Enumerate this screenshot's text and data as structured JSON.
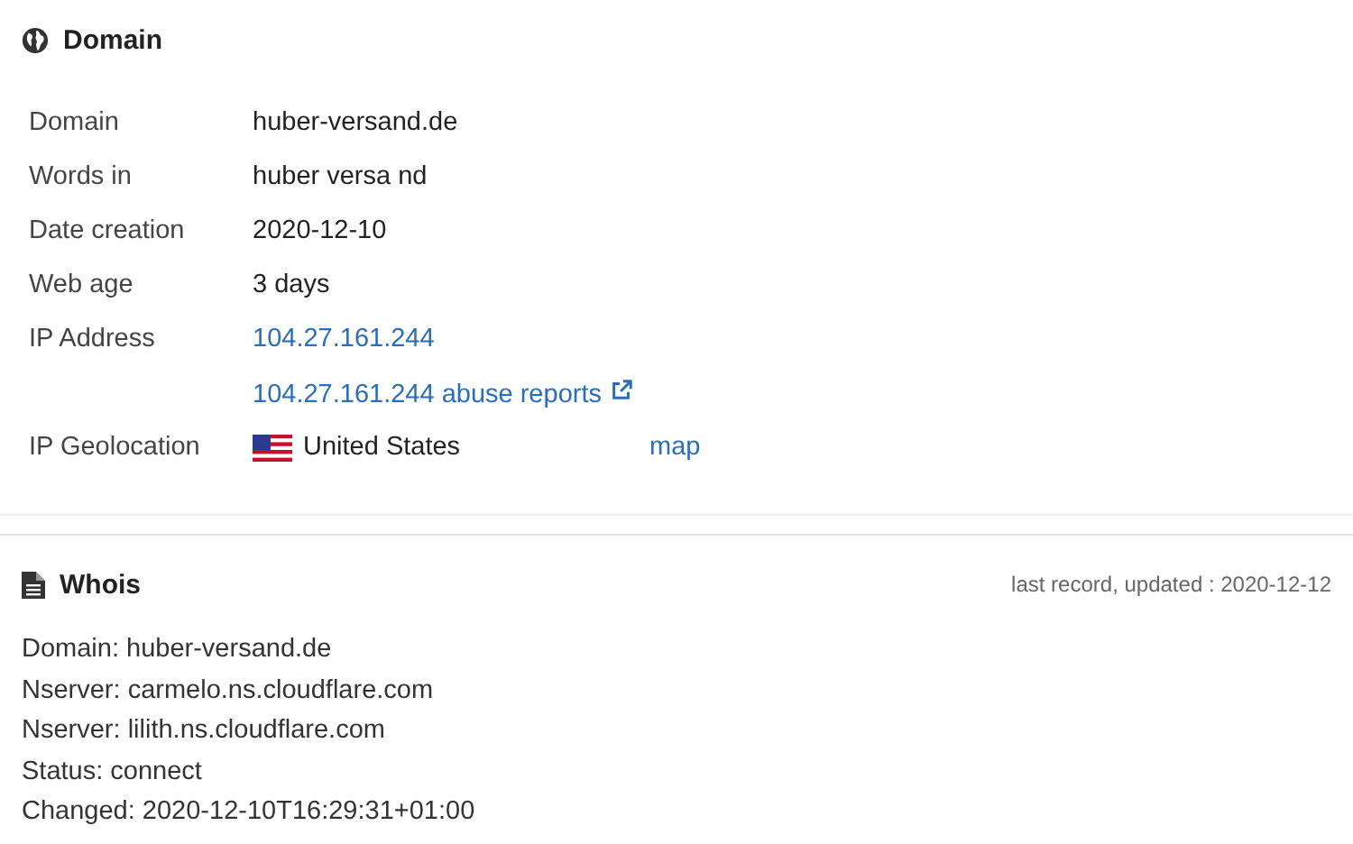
{
  "domain_section": {
    "title": "Domain",
    "rows": [
      {
        "kind": "text",
        "label": "Domain",
        "value": "huber-versand.de"
      },
      {
        "kind": "text",
        "label": "Words in",
        "value": "huber versa nd"
      },
      {
        "kind": "text",
        "label": "Date creation",
        "value": "2020-12-10"
      },
      {
        "kind": "text",
        "label": "Web age",
        "value": "3 days"
      },
      {
        "kind": "link",
        "label": "IP Address",
        "value": "104.27.161.244"
      },
      {
        "kind": "external_link",
        "value": "104.27.161.244 abuse reports"
      },
      {
        "kind": "geo",
        "label": "IP Geolocation",
        "value": "United States",
        "link": "map"
      }
    ]
  },
  "whois_section": {
    "title": "Whois",
    "updated": "last record, updated : 2020-12-12",
    "lines": [
      "Domain: huber-versand.de",
      "Nserver: carmelo.ns.cloudflare.com",
      "Nserver: lilith.ns.cloudflare.com",
      "Status: connect",
      "Changed: 2020-12-10T16:29:31+01:00"
    ]
  }
}
